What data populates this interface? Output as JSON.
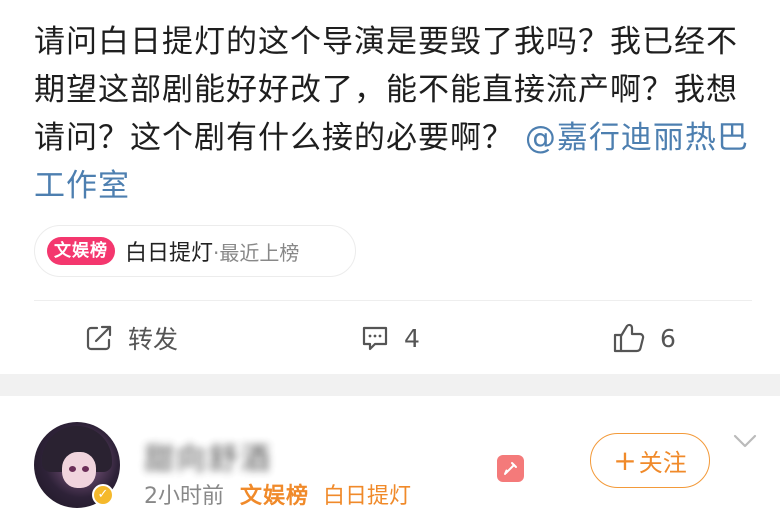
{
  "post": {
    "text": "请问白日提灯的这个导演是要毁了我吗？我已经不期望这部剧能好好改了，能不能直接流产啊？我想请问？这个剧有什么接的必要啊？",
    "mention": "@嘉行迪丽热巴工作室"
  },
  "topic_chip": {
    "badge": "文娱榜",
    "title": "白日提灯",
    "tail": "·最近上榜"
  },
  "actions": {
    "repost_label": "转发",
    "comment_count": "4",
    "like_count": "6"
  },
  "next_post": {
    "username": "甜向舒酒",
    "time": "2小时前",
    "tag": "文娱榜",
    "topic": "白日提灯",
    "follow_label": "关注",
    "follow_plus": "+"
  },
  "colors": {
    "accent_pink": "#f4376e",
    "mention_blue": "#4d7fb0",
    "follow_orange": "#f08a2a"
  },
  "icons": [
    "repost-icon",
    "comment-icon",
    "like-icon",
    "edit-badge-icon",
    "chevron-down-icon",
    "verified-icon"
  ]
}
